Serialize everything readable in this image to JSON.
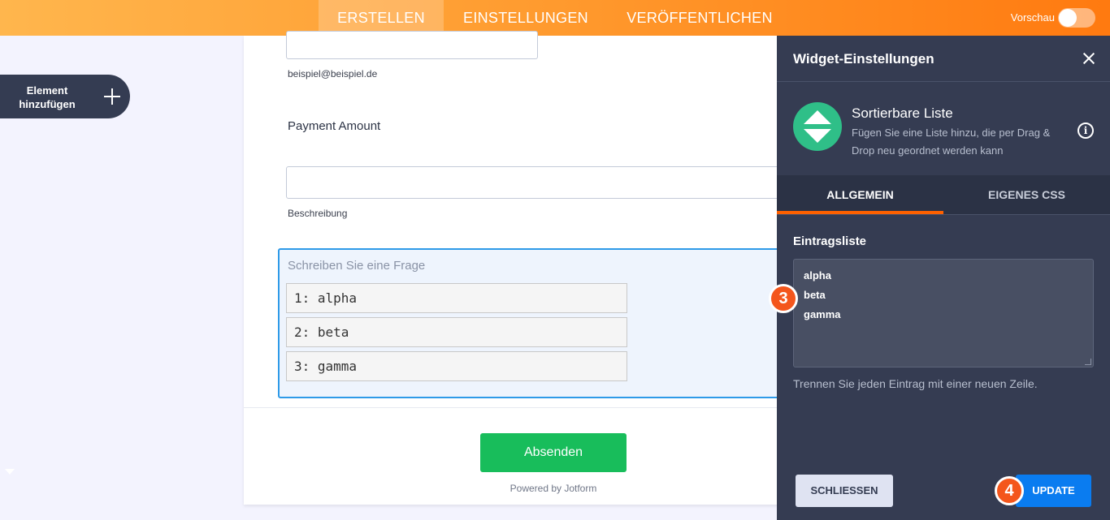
{
  "topbar": {
    "tabs": [
      {
        "label": "ERSTELLEN",
        "active": true
      },
      {
        "label": "EINSTELLUNGEN",
        "active": false
      },
      {
        "label": "VERÖFFENTLICHEN",
        "active": false
      }
    ],
    "preview_label": "Vorschau",
    "preview_enabled": false,
    "accent_start": "#ffb64d",
    "accent_end": "#ff7a10"
  },
  "sidebar": {
    "add_element_label": "Element hinzufügen",
    "add_icon": "plus-icon"
  },
  "form": {
    "email_value": "",
    "email_sublabel": "beispiel@beispiel.de",
    "payment_label": "Payment Amount",
    "payment_value": "",
    "payment_sublabel": "Beschreibung",
    "question_placeholder": "Schreiben Sie eine Frage",
    "sortable_items": [
      "1: alpha",
      "2: beta",
      "3: gamma"
    ],
    "submit_label": "Absenden",
    "submit_color": "#18bd5b",
    "powered_by": "Powered by Jotform"
  },
  "panel": {
    "title": "Widget-Einstellungen",
    "close_icon": "close-icon",
    "widget_name": "Sortierbare Liste",
    "widget_description": "Fügen Sie eine Liste hinzu, die per Drag & Drop neu geordnet werden kann",
    "widget_icon": "sort-arrows-icon",
    "info_icon_glyph": "i",
    "tabs": [
      {
        "label": "ALLGEMEIN",
        "active": true
      },
      {
        "label": "EIGENES CSS",
        "active": false
      }
    ],
    "section_label": "Eintragsliste",
    "entries": [
      "alpha",
      "beta",
      "gamma"
    ],
    "hint": "Trennen Sie jeden Eintrag mit einer neuen Zeile.",
    "close_button": "SCHLIESSEN",
    "update_button": "UPDATE",
    "update_color": "#0a7cf0"
  },
  "annotations": {
    "step_3": "3",
    "step_4": "4",
    "badge_color": "#f4561c"
  }
}
